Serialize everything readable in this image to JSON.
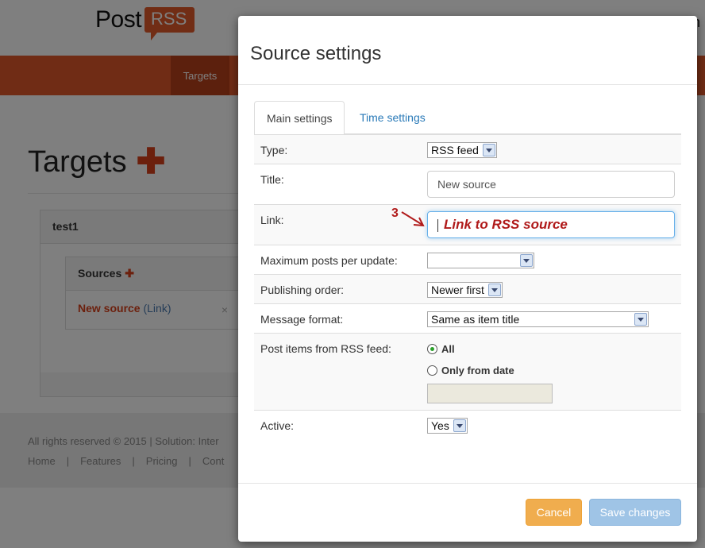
{
  "brand": {
    "post": "Post",
    "rss": "RSS"
  },
  "header": {
    "right_text": "n"
  },
  "nav": {
    "active": "Targets"
  },
  "page": {
    "title": "Targets"
  },
  "target": {
    "name": "test1"
  },
  "sources": {
    "title": "Sources",
    "item_name": "New source",
    "item_link": "(Link)",
    "remove": "×"
  },
  "footer": {
    "copyright": "All rights reserved © 2015 | Solution: Inter",
    "links": [
      "Home",
      "Features",
      "Pricing",
      "Cont"
    ],
    "separator": "|"
  },
  "modal": {
    "title": "Source settings",
    "tabs": [
      {
        "label": "Main settings"
      },
      {
        "label": "Time settings"
      }
    ],
    "fields": {
      "type": {
        "label": "Type:",
        "value": "RSS feed"
      },
      "title": {
        "label": "Title:",
        "value": "New source"
      },
      "link": {
        "label": "Link:",
        "hint": "Link to RSS source",
        "annotation": "3"
      },
      "max_posts": {
        "label": "Maximum posts per update:",
        "value": ""
      },
      "order": {
        "label": "Publishing order:",
        "value": "Newer first"
      },
      "format": {
        "label": "Message format:",
        "value": "Same as item title"
      },
      "post_items": {
        "label": "Post items from RSS feed:",
        "option_all": "All",
        "option_date": "Only from date"
      },
      "active": {
        "label": "Active:",
        "value": "Yes"
      }
    },
    "buttons": {
      "cancel": "Cancel",
      "save": "Save changes"
    }
  },
  "colors": {
    "brand": "#e0582a",
    "nav_active": "#b8401a",
    "accent_red": "#d9401a",
    "link_blue": "#2a7ab8",
    "annotation": "#b01a1a",
    "cancel": "#f0ad4e",
    "save": "#9fc4e6"
  }
}
